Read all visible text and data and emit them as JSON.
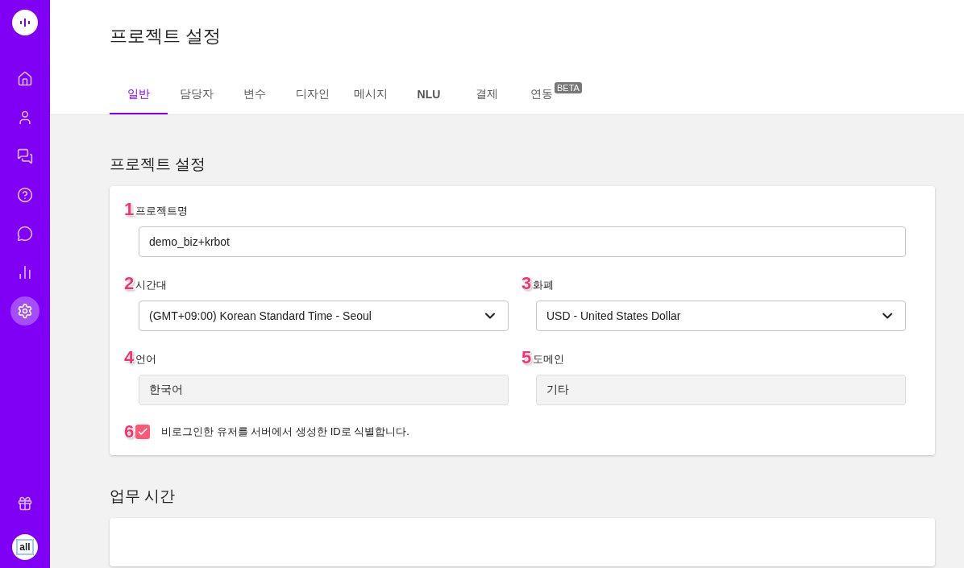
{
  "sidebar": {
    "items": [
      {
        "selected": false
      },
      {
        "selected": false
      },
      {
        "selected": false
      },
      {
        "selected": false
      },
      {
        "selected": false
      },
      {
        "selected": false
      },
      {
        "selected": true
      }
    ],
    "avatar_text": "all"
  },
  "page_title": "프로젝트 설정",
  "tabs": [
    {
      "label": "일반",
      "selected": true
    },
    {
      "label": "담당자",
      "selected": false
    },
    {
      "label": "변수",
      "selected": false
    },
    {
      "label": "디자인",
      "selected": false
    },
    {
      "label": "메시지",
      "selected": false
    },
    {
      "label": "NLU",
      "selected": false,
      "bold": true
    },
    {
      "label": "결제",
      "selected": false
    },
    {
      "label": "연동",
      "selected": false,
      "badge": "BETA"
    }
  ],
  "sections": [
    {
      "title": "프로젝트 설정",
      "rows": [
        [
          {
            "marker": "1",
            "label": "프로젝트명",
            "kind": "text",
            "value": "demo_biz+krbot"
          }
        ],
        [
          {
            "marker": "2",
            "label": "시간대",
            "kind": "select",
            "value": "(GMT+09:00) Korean Standard Time - Seoul"
          },
          {
            "marker": "3",
            "label": "화폐",
            "kind": "select",
            "value": "USD - United States Dollar"
          }
        ],
        [
          {
            "marker": "4",
            "label": "언어",
            "kind": "readonly",
            "value": "한국어"
          },
          {
            "marker": "5",
            "label": "도메인",
            "kind": "readonly",
            "value": "기타"
          }
        ]
      ],
      "checkbox": {
        "marker": "6",
        "label": "비로그인한 유저를 서버에서 생성한 ID로 식별합니다.",
        "checked": true
      }
    },
    {
      "title": "업무 시간"
    }
  ]
}
